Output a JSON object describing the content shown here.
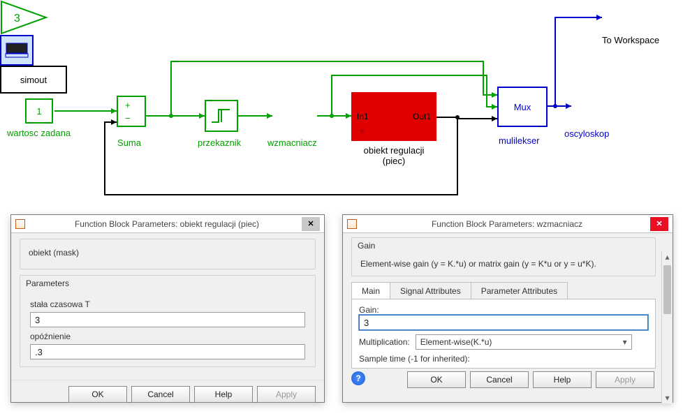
{
  "diagram": {
    "const_value": "1",
    "gain_value": "3",
    "mux_text": "Mux",
    "simout_text": "simout",
    "obj": {
      "port_in": "In1",
      "port_out": "Out1"
    },
    "labels": {
      "const": "wartosc zadana",
      "sum": "Suma",
      "relay": "przekaznik",
      "gain": "wzmacniacz",
      "obj_line1": "obiekt regulacji",
      "obj_line2": "(piec)",
      "mux": "mulilekser",
      "scope": "oscyloskop",
      "simout": "To Workspace"
    }
  },
  "dialog_left": {
    "title": "Function Block Parameters: obiekt regulacji (piec)",
    "maskname": "obiekt (mask)",
    "params_heading": "Parameters",
    "param1_label": "stała czasowa T",
    "param1_value": "3",
    "param2_label": "opóźnienie",
    "param2_value": ".3"
  },
  "dialog_right": {
    "title": "Function Block Parameters: wzmacniacz",
    "heading": "Gain",
    "desc": "Element-wise gain (y = K.*u) or matrix gain (y = K*u or y = u*K).",
    "tabs": [
      "Main",
      "Signal Attributes",
      "Parameter Attributes"
    ],
    "gain_label": "Gain:",
    "gain_value": "3",
    "mult_label": "Multiplication:",
    "mult_value": "Element-wise(K.*u)",
    "sampletime_label": "Sample time (-1 for inherited):"
  },
  "buttons": {
    "ok": "OK",
    "cancel": "Cancel",
    "help": "Help",
    "apply": "Apply"
  }
}
